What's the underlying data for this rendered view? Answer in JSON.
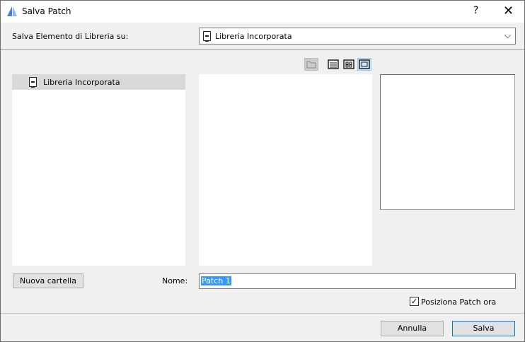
{
  "window": {
    "title": "Salva Patch",
    "help": "?",
    "close": "✕"
  },
  "location": {
    "label": "Salva Elemento di Libreria su:",
    "selected": "Libreria Incorporata"
  },
  "tree": {
    "items": [
      {
        "label": "Libreria Incorporata"
      }
    ]
  },
  "name": {
    "label": "Nome:",
    "value": "Patch 1"
  },
  "buttons": {
    "new_folder": "Nuova cartella",
    "cancel": "Annulla",
    "save": "Salva"
  },
  "checkbox": {
    "label": "Posiziona Patch ora",
    "checked": true
  }
}
